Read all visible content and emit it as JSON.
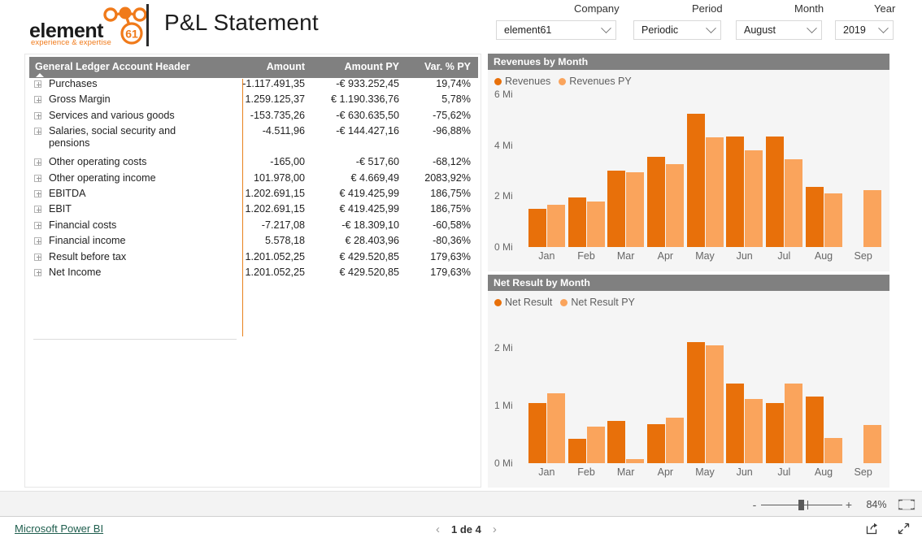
{
  "header": {
    "logo_word": "element",
    "logo_badge": "61",
    "logo_tagline": "experience & expertise",
    "title": "P&L Statement",
    "brand_orange": "#F07A1A"
  },
  "slicers": [
    {
      "label": "Company",
      "value": "element61",
      "icon": "chevron-down-icon"
    },
    {
      "label": "Period",
      "value": "Periodic",
      "icon": "chevron-down-icon"
    },
    {
      "label": "Month",
      "value": "August",
      "icon": "chevron-down-icon"
    },
    {
      "label": "Year",
      "value": "2019",
      "icon": "chevron-down-icon"
    }
  ],
  "table": {
    "columns": [
      "General Ledger Account Header",
      "Amount",
      "Amount PY",
      "Var. % PY"
    ],
    "sort_indicator": "ascending-caret-icon",
    "rows": [
      {
        "name": "Purchases",
        "amount": "-1.117.491,35",
        "amount_py": "-€ 933.252,45",
        "var_py": "19,74%"
      },
      {
        "name": "Gross Margin",
        "amount": "1.259.125,37",
        "amount_py": "€ 1.190.336,76",
        "var_py": "5,78%"
      },
      {
        "name": "Services and various goods",
        "amount": "-153.735,26",
        "amount_py": "-€ 630.635,50",
        "var_py": "-75,62%"
      },
      {
        "name": "Salaries, social security and pensions",
        "amount": "-4.511,96",
        "amount_py": "-€ 144.427,16",
        "var_py": "-96,88%"
      },
      {
        "name": "Other operating costs",
        "amount": "-165,00",
        "amount_py": "-€ 517,60",
        "var_py": "-68,12%"
      },
      {
        "name": "Other operating income",
        "amount": "101.978,00",
        "amount_py": "€ 4.669,49",
        "var_py": "2083,92%"
      },
      {
        "name": "EBITDA",
        "amount": "1.202.691,15",
        "amount_py": "€ 419.425,99",
        "var_py": "186,75%"
      },
      {
        "name": "EBIT",
        "amount": "1.202.691,15",
        "amount_py": "€ 419.425,99",
        "var_py": "186,75%"
      },
      {
        "name": "Financial costs",
        "amount": "-7.217,08",
        "amount_py": "-€ 18.309,10",
        "var_py": "-60,58%"
      },
      {
        "name": "Financial income",
        "amount": "5.578,18",
        "amount_py": "€ 28.403,96",
        "var_py": "-80,36%"
      },
      {
        "name": "Result before tax",
        "amount": "1.201.052,25",
        "amount_py": "€ 429.520,85",
        "var_py": "179,63%"
      },
      {
        "name": "Net Income",
        "amount": "1.201.052,25",
        "amount_py": "€ 429.520,85",
        "var_py": "179,63%"
      }
    ]
  },
  "chart_data": [
    {
      "type": "bar",
      "title": "Revenues by Month",
      "categories": [
        "Jan",
        "Feb",
        "Mar",
        "Apr",
        "May",
        "Jun",
        "Jul",
        "Aug",
        "Sep"
      ],
      "series": [
        {
          "name": "Revenues",
          "color": "#E8700A",
          "values": [
            1.5,
            1.95,
            3.0,
            3.55,
            5.25,
            4.35,
            4.35,
            2.35,
            null
          ]
        },
        {
          "name": "Revenues PY",
          "color": "#FAA45C",
          "values": [
            1.65,
            1.78,
            2.95,
            3.25,
            4.3,
            3.8,
            3.45,
            2.1,
            2.25
          ]
        }
      ],
      "xlabel": "",
      "ylabel": "",
      "ylim": [
        0,
        6
      ],
      "yticks": [
        0,
        2,
        4,
        6
      ],
      "ytick_labels": [
        "0 Mi",
        "2 Mi",
        "4 Mi",
        "6 Mi"
      ],
      "unit": "Mi",
      "grid": false,
      "legend_position": "top-left"
    },
    {
      "type": "bar",
      "title": "Net Result by Month",
      "categories": [
        "Jan",
        "Feb",
        "Mar",
        "Apr",
        "May",
        "Jun",
        "Jul",
        "Aug",
        "Sep"
      ],
      "series": [
        {
          "name": "Net Result",
          "color": "#E8700A",
          "values": [
            1.04,
            0.42,
            0.73,
            0.68,
            2.1,
            1.38,
            1.05,
            1.16,
            null
          ]
        },
        {
          "name": "Net Result PY",
          "color": "#FAA45C",
          "values": [
            1.22,
            0.64,
            0.07,
            0.79,
            2.05,
            1.11,
            1.38,
            0.44,
            0.67
          ]
        }
      ],
      "xlabel": "",
      "ylabel": "",
      "ylim": [
        0,
        2.4
      ],
      "yticks": [
        0,
        1,
        2
      ],
      "ytick_labels": [
        "0 Mi",
        "1 Mi",
        "2 Mi"
      ],
      "unit": "Mi",
      "grid": false,
      "legend_position": "top-left"
    }
  ],
  "zoom_bar": {
    "minus": "-",
    "plus": "+",
    "level": "84%",
    "fit_icon": "fit-to-page-icon"
  },
  "footer": {
    "link": "Microsoft Power BI",
    "prev_icon": "chevron-left-icon",
    "page_label": "1 de 4",
    "next_icon": "chevron-right-icon",
    "share_icon": "share-icon",
    "fullscreen_icon": "fullscreen-icon"
  }
}
